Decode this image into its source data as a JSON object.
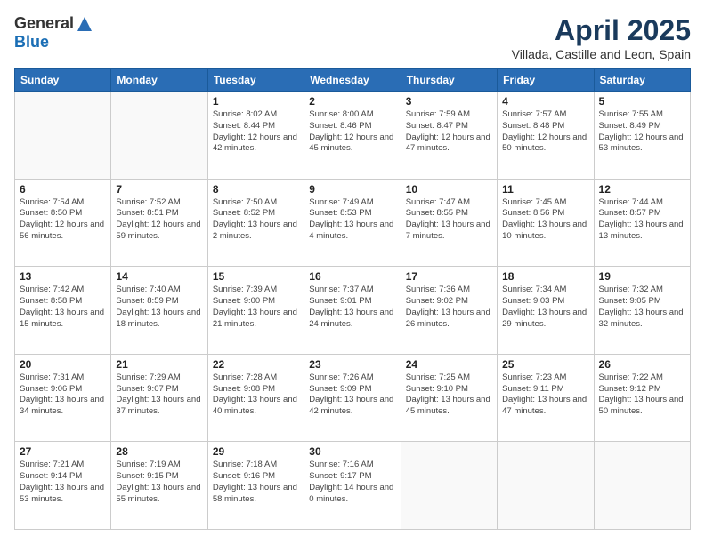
{
  "logo": {
    "general": "General",
    "blue": "Blue"
  },
  "title": "April 2025",
  "location": "Villada, Castille and Leon, Spain",
  "days_header": [
    "Sunday",
    "Monday",
    "Tuesday",
    "Wednesday",
    "Thursday",
    "Friday",
    "Saturday"
  ],
  "weeks": [
    [
      {
        "day": "",
        "content": ""
      },
      {
        "day": "",
        "content": ""
      },
      {
        "day": "1",
        "content": "Sunrise: 8:02 AM\nSunset: 8:44 PM\nDaylight: 12 hours and 42 minutes."
      },
      {
        "day": "2",
        "content": "Sunrise: 8:00 AM\nSunset: 8:46 PM\nDaylight: 12 hours and 45 minutes."
      },
      {
        "day": "3",
        "content": "Sunrise: 7:59 AM\nSunset: 8:47 PM\nDaylight: 12 hours and 47 minutes."
      },
      {
        "day": "4",
        "content": "Sunrise: 7:57 AM\nSunset: 8:48 PM\nDaylight: 12 hours and 50 minutes."
      },
      {
        "day": "5",
        "content": "Sunrise: 7:55 AM\nSunset: 8:49 PM\nDaylight: 12 hours and 53 minutes."
      }
    ],
    [
      {
        "day": "6",
        "content": "Sunrise: 7:54 AM\nSunset: 8:50 PM\nDaylight: 12 hours and 56 minutes."
      },
      {
        "day": "7",
        "content": "Sunrise: 7:52 AM\nSunset: 8:51 PM\nDaylight: 12 hours and 59 minutes."
      },
      {
        "day": "8",
        "content": "Sunrise: 7:50 AM\nSunset: 8:52 PM\nDaylight: 13 hours and 2 minutes."
      },
      {
        "day": "9",
        "content": "Sunrise: 7:49 AM\nSunset: 8:53 PM\nDaylight: 13 hours and 4 minutes."
      },
      {
        "day": "10",
        "content": "Sunrise: 7:47 AM\nSunset: 8:55 PM\nDaylight: 13 hours and 7 minutes."
      },
      {
        "day": "11",
        "content": "Sunrise: 7:45 AM\nSunset: 8:56 PM\nDaylight: 13 hours and 10 minutes."
      },
      {
        "day": "12",
        "content": "Sunrise: 7:44 AM\nSunset: 8:57 PM\nDaylight: 13 hours and 13 minutes."
      }
    ],
    [
      {
        "day": "13",
        "content": "Sunrise: 7:42 AM\nSunset: 8:58 PM\nDaylight: 13 hours and 15 minutes."
      },
      {
        "day": "14",
        "content": "Sunrise: 7:40 AM\nSunset: 8:59 PM\nDaylight: 13 hours and 18 minutes."
      },
      {
        "day": "15",
        "content": "Sunrise: 7:39 AM\nSunset: 9:00 PM\nDaylight: 13 hours and 21 minutes."
      },
      {
        "day": "16",
        "content": "Sunrise: 7:37 AM\nSunset: 9:01 PM\nDaylight: 13 hours and 24 minutes."
      },
      {
        "day": "17",
        "content": "Sunrise: 7:36 AM\nSunset: 9:02 PM\nDaylight: 13 hours and 26 minutes."
      },
      {
        "day": "18",
        "content": "Sunrise: 7:34 AM\nSunset: 9:03 PM\nDaylight: 13 hours and 29 minutes."
      },
      {
        "day": "19",
        "content": "Sunrise: 7:32 AM\nSunset: 9:05 PM\nDaylight: 13 hours and 32 minutes."
      }
    ],
    [
      {
        "day": "20",
        "content": "Sunrise: 7:31 AM\nSunset: 9:06 PM\nDaylight: 13 hours and 34 minutes."
      },
      {
        "day": "21",
        "content": "Sunrise: 7:29 AM\nSunset: 9:07 PM\nDaylight: 13 hours and 37 minutes."
      },
      {
        "day": "22",
        "content": "Sunrise: 7:28 AM\nSunset: 9:08 PM\nDaylight: 13 hours and 40 minutes."
      },
      {
        "day": "23",
        "content": "Sunrise: 7:26 AM\nSunset: 9:09 PM\nDaylight: 13 hours and 42 minutes."
      },
      {
        "day": "24",
        "content": "Sunrise: 7:25 AM\nSunset: 9:10 PM\nDaylight: 13 hours and 45 minutes."
      },
      {
        "day": "25",
        "content": "Sunrise: 7:23 AM\nSunset: 9:11 PM\nDaylight: 13 hours and 47 minutes."
      },
      {
        "day": "26",
        "content": "Sunrise: 7:22 AM\nSunset: 9:12 PM\nDaylight: 13 hours and 50 minutes."
      }
    ],
    [
      {
        "day": "27",
        "content": "Sunrise: 7:21 AM\nSunset: 9:14 PM\nDaylight: 13 hours and 53 minutes."
      },
      {
        "day": "28",
        "content": "Sunrise: 7:19 AM\nSunset: 9:15 PM\nDaylight: 13 hours and 55 minutes."
      },
      {
        "day": "29",
        "content": "Sunrise: 7:18 AM\nSunset: 9:16 PM\nDaylight: 13 hours and 58 minutes."
      },
      {
        "day": "30",
        "content": "Sunrise: 7:16 AM\nSunset: 9:17 PM\nDaylight: 14 hours and 0 minutes."
      },
      {
        "day": "",
        "content": ""
      },
      {
        "day": "",
        "content": ""
      },
      {
        "day": "",
        "content": ""
      }
    ]
  ]
}
